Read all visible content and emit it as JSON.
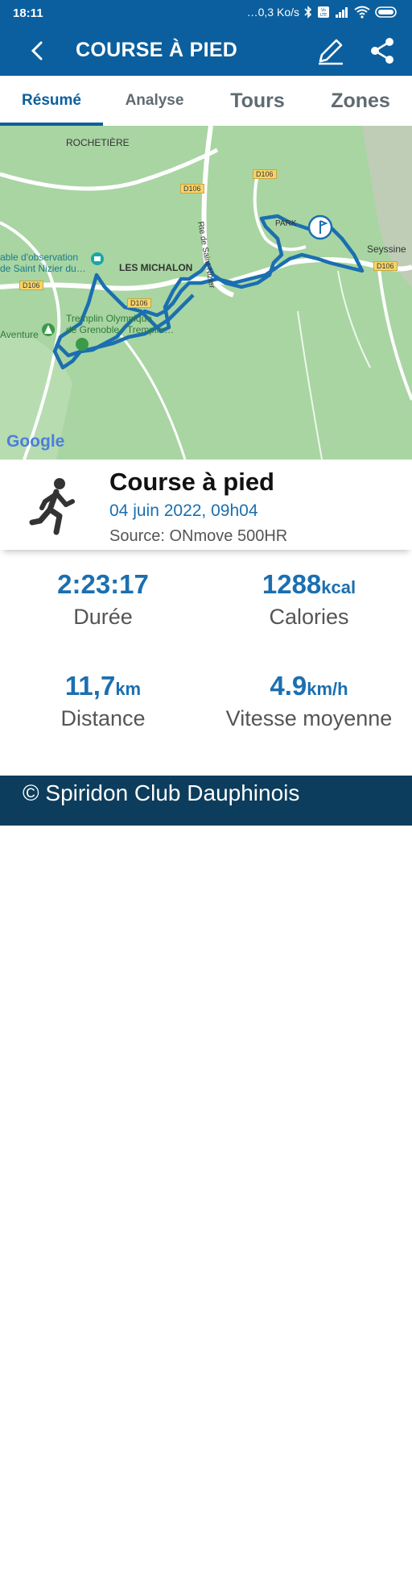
{
  "status_bar": {
    "time": "18:11",
    "network_speed": "…0,3 Ko/s",
    "icons": [
      "bluetooth-icon",
      "volte-icon",
      "signal-icon",
      "wifi-icon",
      "battery-icon"
    ]
  },
  "app_bar": {
    "title": "COURSE À PIED",
    "icons": [
      "back-arrow-icon",
      "edit-pencil-icon",
      "share-icon"
    ]
  },
  "tabs": [
    {
      "label": "Résumé",
      "active": true
    },
    {
      "label": "Analyse",
      "active": false
    },
    {
      "label": "Tours",
      "active": false
    },
    {
      "label": "Zones",
      "active": false
    }
  ],
  "map": {
    "labels": {
      "rochetiere": "ROCHETIÈRE",
      "michalon": "LES MICHALON",
      "seyssinet": "Seyssine",
      "observation_1": "able d'observation",
      "observation_2": "de Saint Nizier du…",
      "tremplin_1": "Tremplin Olympique",
      "tremplin_2": "de Grenoble / Tremplin…",
      "aventure": "Aventure",
      "route": "Rte de Saint-Nizier",
      "parking": "PARK"
    },
    "road_badges": [
      "D106",
      "D106",
      "D106",
      "D106",
      "D106"
    ],
    "attribution": "Google",
    "route_color": "#1b6fb0"
  },
  "activity": {
    "title": "Course à pied",
    "date": "04 juin 2022, 09h04",
    "source": "Source: ONmove 500HR",
    "icon": "runner-icon"
  },
  "stats": {
    "duration": {
      "value": "2:23:17",
      "unit": "",
      "label": "Durée"
    },
    "calories": {
      "value": "1288",
      "unit": "kcal",
      "label": "Calories"
    },
    "distance": {
      "value": "11,7",
      "unit": "km",
      "label": "Distance"
    },
    "speed": {
      "value": "4.9",
      "unit": "km/h",
      "label": "Vitesse moyenne"
    }
  },
  "footer": {
    "text": "© Spiridon Club Dauphinois"
  },
  "colors": {
    "primary": "#0b5f9e",
    "accent": "#1b6fb0",
    "footer": "#0d3d5c",
    "map_green": "#a8d5a2"
  }
}
